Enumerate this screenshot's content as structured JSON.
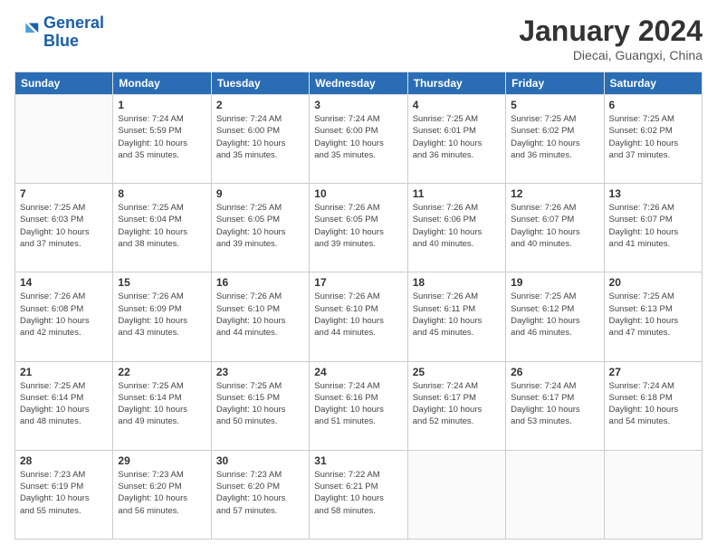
{
  "header": {
    "logo_line1": "General",
    "logo_line2": "Blue",
    "title": "January 2024",
    "subtitle": "Diecai, Guangxi, China"
  },
  "weekdays": [
    "Sunday",
    "Monday",
    "Tuesday",
    "Wednesday",
    "Thursday",
    "Friday",
    "Saturday"
  ],
  "weeks": [
    [
      {
        "day": "",
        "info": ""
      },
      {
        "day": "1",
        "info": "Sunrise: 7:24 AM\nSunset: 5:59 PM\nDaylight: 10 hours\nand 35 minutes."
      },
      {
        "day": "2",
        "info": "Sunrise: 7:24 AM\nSunset: 6:00 PM\nDaylight: 10 hours\nand 35 minutes."
      },
      {
        "day": "3",
        "info": "Sunrise: 7:24 AM\nSunset: 6:00 PM\nDaylight: 10 hours\nand 35 minutes."
      },
      {
        "day": "4",
        "info": "Sunrise: 7:25 AM\nSunset: 6:01 PM\nDaylight: 10 hours\nand 36 minutes."
      },
      {
        "day": "5",
        "info": "Sunrise: 7:25 AM\nSunset: 6:02 PM\nDaylight: 10 hours\nand 36 minutes."
      },
      {
        "day": "6",
        "info": "Sunrise: 7:25 AM\nSunset: 6:02 PM\nDaylight: 10 hours\nand 37 minutes."
      }
    ],
    [
      {
        "day": "7",
        "info": "Sunrise: 7:25 AM\nSunset: 6:03 PM\nDaylight: 10 hours\nand 37 minutes."
      },
      {
        "day": "8",
        "info": "Sunrise: 7:25 AM\nSunset: 6:04 PM\nDaylight: 10 hours\nand 38 minutes."
      },
      {
        "day": "9",
        "info": "Sunrise: 7:25 AM\nSunset: 6:05 PM\nDaylight: 10 hours\nand 39 minutes."
      },
      {
        "day": "10",
        "info": "Sunrise: 7:26 AM\nSunset: 6:05 PM\nDaylight: 10 hours\nand 39 minutes."
      },
      {
        "day": "11",
        "info": "Sunrise: 7:26 AM\nSunset: 6:06 PM\nDaylight: 10 hours\nand 40 minutes."
      },
      {
        "day": "12",
        "info": "Sunrise: 7:26 AM\nSunset: 6:07 PM\nDaylight: 10 hours\nand 40 minutes."
      },
      {
        "day": "13",
        "info": "Sunrise: 7:26 AM\nSunset: 6:07 PM\nDaylight: 10 hours\nand 41 minutes."
      }
    ],
    [
      {
        "day": "14",
        "info": "Sunrise: 7:26 AM\nSunset: 6:08 PM\nDaylight: 10 hours\nand 42 minutes."
      },
      {
        "day": "15",
        "info": "Sunrise: 7:26 AM\nSunset: 6:09 PM\nDaylight: 10 hours\nand 43 minutes."
      },
      {
        "day": "16",
        "info": "Sunrise: 7:26 AM\nSunset: 6:10 PM\nDaylight: 10 hours\nand 44 minutes."
      },
      {
        "day": "17",
        "info": "Sunrise: 7:26 AM\nSunset: 6:10 PM\nDaylight: 10 hours\nand 44 minutes."
      },
      {
        "day": "18",
        "info": "Sunrise: 7:26 AM\nSunset: 6:11 PM\nDaylight: 10 hours\nand 45 minutes."
      },
      {
        "day": "19",
        "info": "Sunrise: 7:25 AM\nSunset: 6:12 PM\nDaylight: 10 hours\nand 46 minutes."
      },
      {
        "day": "20",
        "info": "Sunrise: 7:25 AM\nSunset: 6:13 PM\nDaylight: 10 hours\nand 47 minutes."
      }
    ],
    [
      {
        "day": "21",
        "info": "Sunrise: 7:25 AM\nSunset: 6:14 PM\nDaylight: 10 hours\nand 48 minutes."
      },
      {
        "day": "22",
        "info": "Sunrise: 7:25 AM\nSunset: 6:14 PM\nDaylight: 10 hours\nand 49 minutes."
      },
      {
        "day": "23",
        "info": "Sunrise: 7:25 AM\nSunset: 6:15 PM\nDaylight: 10 hours\nand 50 minutes."
      },
      {
        "day": "24",
        "info": "Sunrise: 7:24 AM\nSunset: 6:16 PM\nDaylight: 10 hours\nand 51 minutes."
      },
      {
        "day": "25",
        "info": "Sunrise: 7:24 AM\nSunset: 6:17 PM\nDaylight: 10 hours\nand 52 minutes."
      },
      {
        "day": "26",
        "info": "Sunrise: 7:24 AM\nSunset: 6:17 PM\nDaylight: 10 hours\nand 53 minutes."
      },
      {
        "day": "27",
        "info": "Sunrise: 7:24 AM\nSunset: 6:18 PM\nDaylight: 10 hours\nand 54 minutes."
      }
    ],
    [
      {
        "day": "28",
        "info": "Sunrise: 7:23 AM\nSunset: 6:19 PM\nDaylight: 10 hours\nand 55 minutes."
      },
      {
        "day": "29",
        "info": "Sunrise: 7:23 AM\nSunset: 6:20 PM\nDaylight: 10 hours\nand 56 minutes."
      },
      {
        "day": "30",
        "info": "Sunrise: 7:23 AM\nSunset: 6:20 PM\nDaylight: 10 hours\nand 57 minutes."
      },
      {
        "day": "31",
        "info": "Sunrise: 7:22 AM\nSunset: 6:21 PM\nDaylight: 10 hours\nand 58 minutes."
      },
      {
        "day": "",
        "info": ""
      },
      {
        "day": "",
        "info": ""
      },
      {
        "day": "",
        "info": ""
      }
    ]
  ]
}
